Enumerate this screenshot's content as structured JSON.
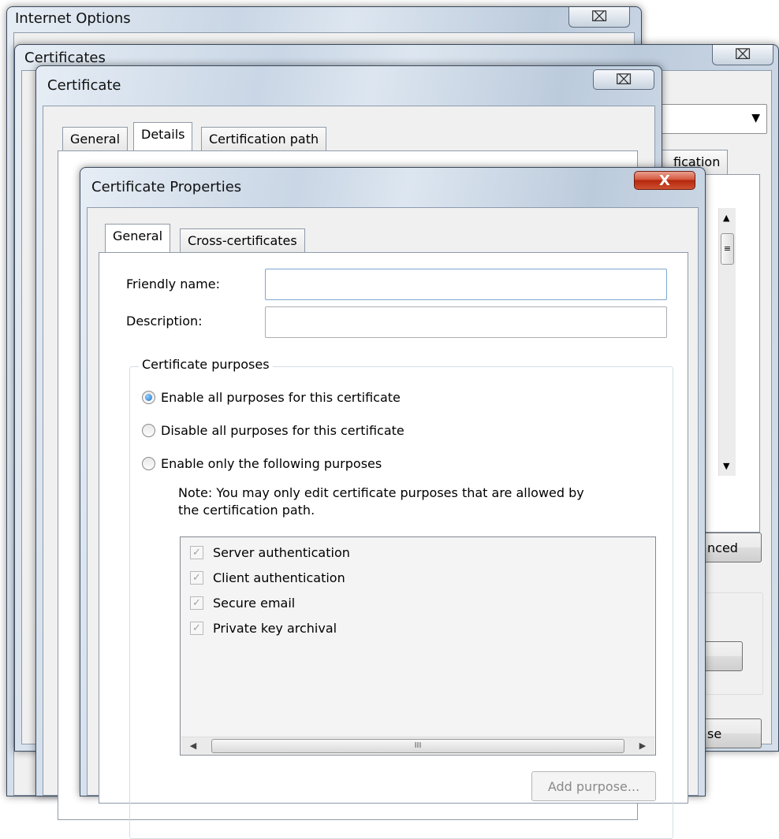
{
  "internet_options": {
    "title": "Internet Options",
    "close_glyph": "⌧"
  },
  "certificates": {
    "title": "Certificates",
    "close_glyph": "⌧",
    "partial_tab_label": "fication",
    "advanced_button_partial": "nced",
    "close_button_partial": "se"
  },
  "certificate": {
    "title": "Certificate",
    "close_glyph": "⌧",
    "tabs": [
      "General",
      "Details",
      "Certification path"
    ],
    "selected_tab": "Details"
  },
  "properties": {
    "title": "Certificate Properties",
    "close_glyph": "X",
    "tabs": [
      "General",
      "Cross-certificates"
    ],
    "selected_tab": "General",
    "friendly_name_label": "Friendly name:",
    "friendly_name_value": "",
    "description_label": "Description:",
    "description_value": "",
    "purposes_group_label": "Certificate purposes",
    "radio_options": [
      {
        "label": "Enable all purposes for this certificate",
        "selected": true
      },
      {
        "label": "Disable all purposes for this certificate",
        "selected": false
      },
      {
        "label": "Enable only the following purposes",
        "selected": false
      }
    ],
    "note_line1": "Note: You may only edit certificate purposes that are allowed by",
    "note_line2": "the certification path.",
    "purposes": [
      {
        "label": "Server authentication",
        "checked": true,
        "enabled": false
      },
      {
        "label": "Client authentication",
        "checked": true,
        "enabled": false
      },
      {
        "label": "Secure email",
        "checked": true,
        "enabled": false
      },
      {
        "label": "Private key archival",
        "checked": true,
        "enabled": false
      }
    ],
    "scroll_thumb_glyph": "III",
    "add_purpose_button": "Add purpose..."
  }
}
